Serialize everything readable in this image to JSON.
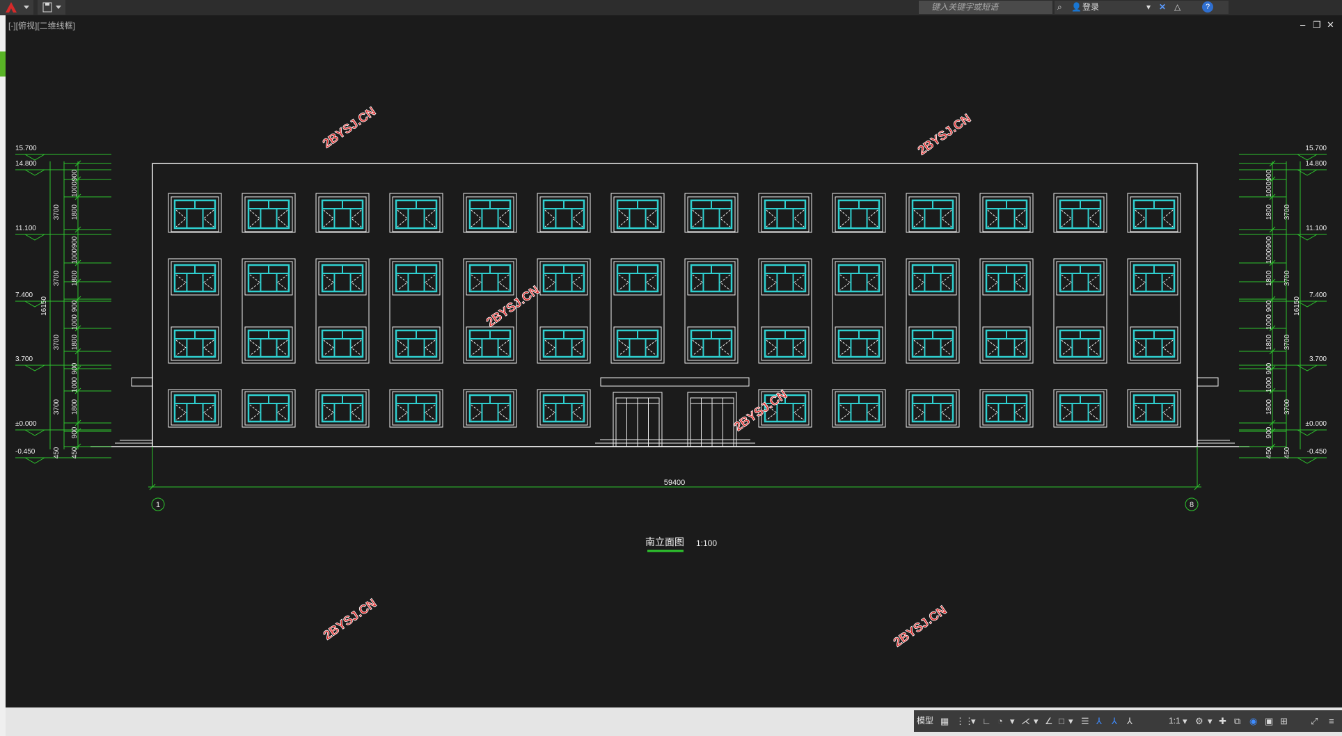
{
  "titlebar": {
    "app_icon": "autocad-logo-icon",
    "search_placeholder": "键入关键字或短语",
    "login_label": "登录"
  },
  "viewport": {
    "view_label": "[-][俯视][二维线框]"
  },
  "drawing": {
    "title": "南立面图",
    "scale": "1:100",
    "total_width_dim": "59400",
    "axis_left": "1",
    "axis_right": "8",
    "total_height_dim": "16150",
    "elevations": [
      "15.700",
      "14.800",
      "11.100",
      "7.400",
      "3.700",
      "±0.000",
      "-0.450"
    ],
    "dims_left": [
      "900",
      "1000",
      "1800",
      "3700",
      "900",
      "1000",
      "1800",
      "3700",
      "900",
      "1000",
      "1800",
      "3700",
      "900",
      "1000",
      "1800",
      "3700",
      "900",
      "450",
      "450"
    ],
    "watermark": "2BYSJ.CN"
  },
  "statusbar": {
    "model_label": "模型",
    "zoom_label": "1:1"
  },
  "colors": {
    "background": "#1b1b1b",
    "window_cyan": "#2fd0d0",
    "dim_green": "#2ec52e",
    "line_white": "#f0f0f0",
    "watermark_red": "#e03030"
  }
}
